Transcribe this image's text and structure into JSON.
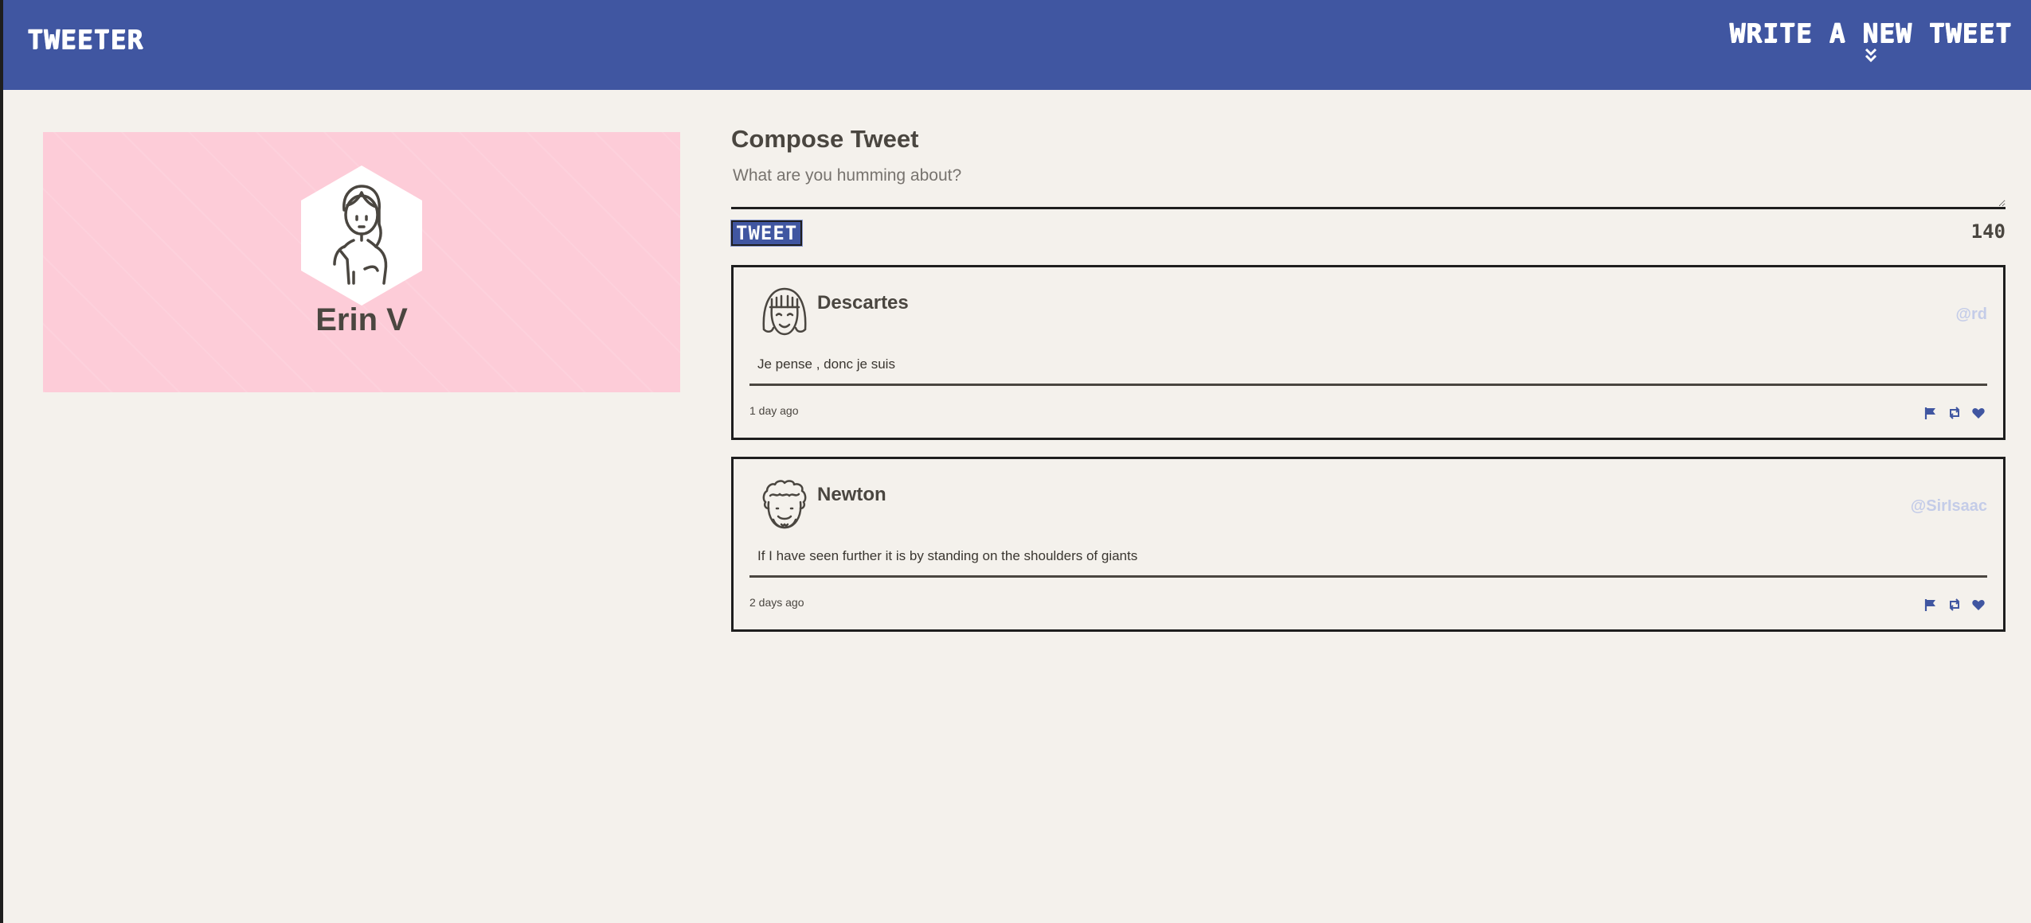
{
  "nav": {
    "brand": "TWEETER",
    "compose_toggle": "WRITE A NEW TWEET",
    "compose_toggle_icon": "double-chevron-down-icon"
  },
  "profile": {
    "name": "Erin V",
    "avatar_icon": "woman-avatar-icon",
    "background_color": "#fdccd8"
  },
  "compose": {
    "title": "Compose Tweet",
    "placeholder": "What are you humming about?",
    "value": "",
    "submit_label": "TWEET",
    "char_counter": "140"
  },
  "tweets": [
    {
      "author": "Descartes",
      "handle": "@rd",
      "avatar_icon": "bob-hair-avatar-icon",
      "text": "Je pense , donc je suis",
      "time": "1 day ago",
      "actions": [
        "flag-icon",
        "retweet-icon",
        "heart-icon"
      ]
    },
    {
      "author": "Newton",
      "handle": "@SirIsaac",
      "avatar_icon": "curly-hair-avatar-icon",
      "text": "If I have seen further it is by standing on the shoulders of giants",
      "time": "2 days ago",
      "actions": [
        "flag-icon",
        "retweet-icon",
        "heart-icon"
      ]
    }
  ],
  "colors": {
    "nav": "#4056a1",
    "page_background": "#f4f1ec",
    "text": "#4a4640",
    "handle": "#c4cce8",
    "icon": "#4056a1"
  }
}
